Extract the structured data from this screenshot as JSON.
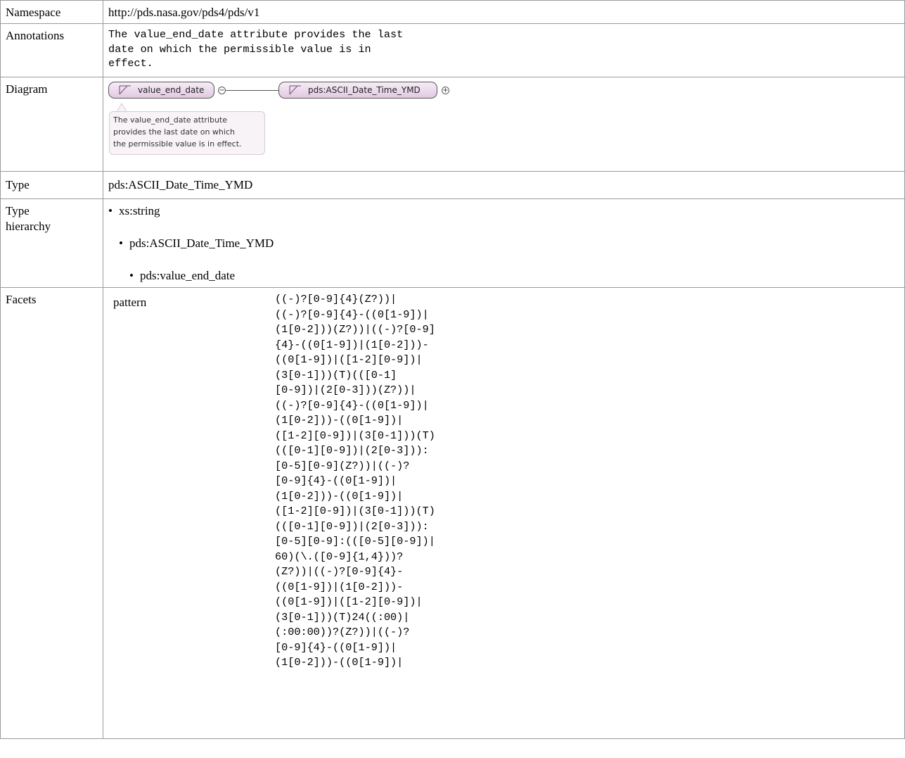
{
  "rows": {
    "namespace": {
      "label": "Namespace",
      "value": "http://pds.nasa.gov/pds4/pds/v1"
    },
    "annotations": {
      "label": "Annotations",
      "value": "The value_end_date attribute provides the last\ndate on which the permissible value is in\neffect."
    },
    "diagram": {
      "label": "Diagram",
      "node_attribute": "value_end_date",
      "node_type": "pds:ASCII_Date_Time_YMD",
      "collapse_symbol": "−",
      "expand_symbol": "+",
      "tooltip_lines": [
        "The value_end_date attribute",
        "provides the last date on which",
        "the permissible value is in effect."
      ]
    },
    "type": {
      "label": "Type",
      "value": "pds:ASCII_Date_Time_YMD"
    },
    "hierarchy": {
      "label": "Type\nhierarchy",
      "bullet": "•",
      "items": [
        "xs:string",
        "pds:ASCII_Date_Time_YMD",
        "pds:value_end_date"
      ]
    },
    "facets": {
      "label": "Facets",
      "name": "pattern",
      "value": "((-)?[0-9]{4}(Z?))|\n((-)?[0-9]{4}-((0[1-9])|\n(1[0-2]))(Z?))|((-)?[0-9]\n{4}-((0[1-9])|(1[0-2]))-\n((0[1-9])|([1-2][0-9])|\n(3[0-1]))(T)(([0-1]\n[0-9])|(2[0-3]))(Z?))|\n((-)?[0-9]{4}-((0[1-9])|\n(1[0-2]))-((0[1-9])|\n([1-2][0-9])|(3[0-1]))(T)\n(([0-1][0-9])|(2[0-3])):\n[0-5][0-9](Z?))|((-)?\n[0-9]{4}-((0[1-9])|\n(1[0-2]))-((0[1-9])|\n([1-2][0-9])|(3[0-1]))(T)\n(([0-1][0-9])|(2[0-3])):\n[0-5][0-9]:(([0-5][0-9])|\n60)(\\.([0-9]{1,4}))?\n(Z?))|((-)?[0-9]{4}-\n((0[1-9])|(1[0-2]))-\n((0[1-9])|([1-2][0-9])|\n(3[0-1]))(T)24((:00)|\n(:00:00))?(Z?))|((-)?\n[0-9]{4}-((0[1-9])|\n(1[0-2]))-((0[1-9])|"
    }
  }
}
